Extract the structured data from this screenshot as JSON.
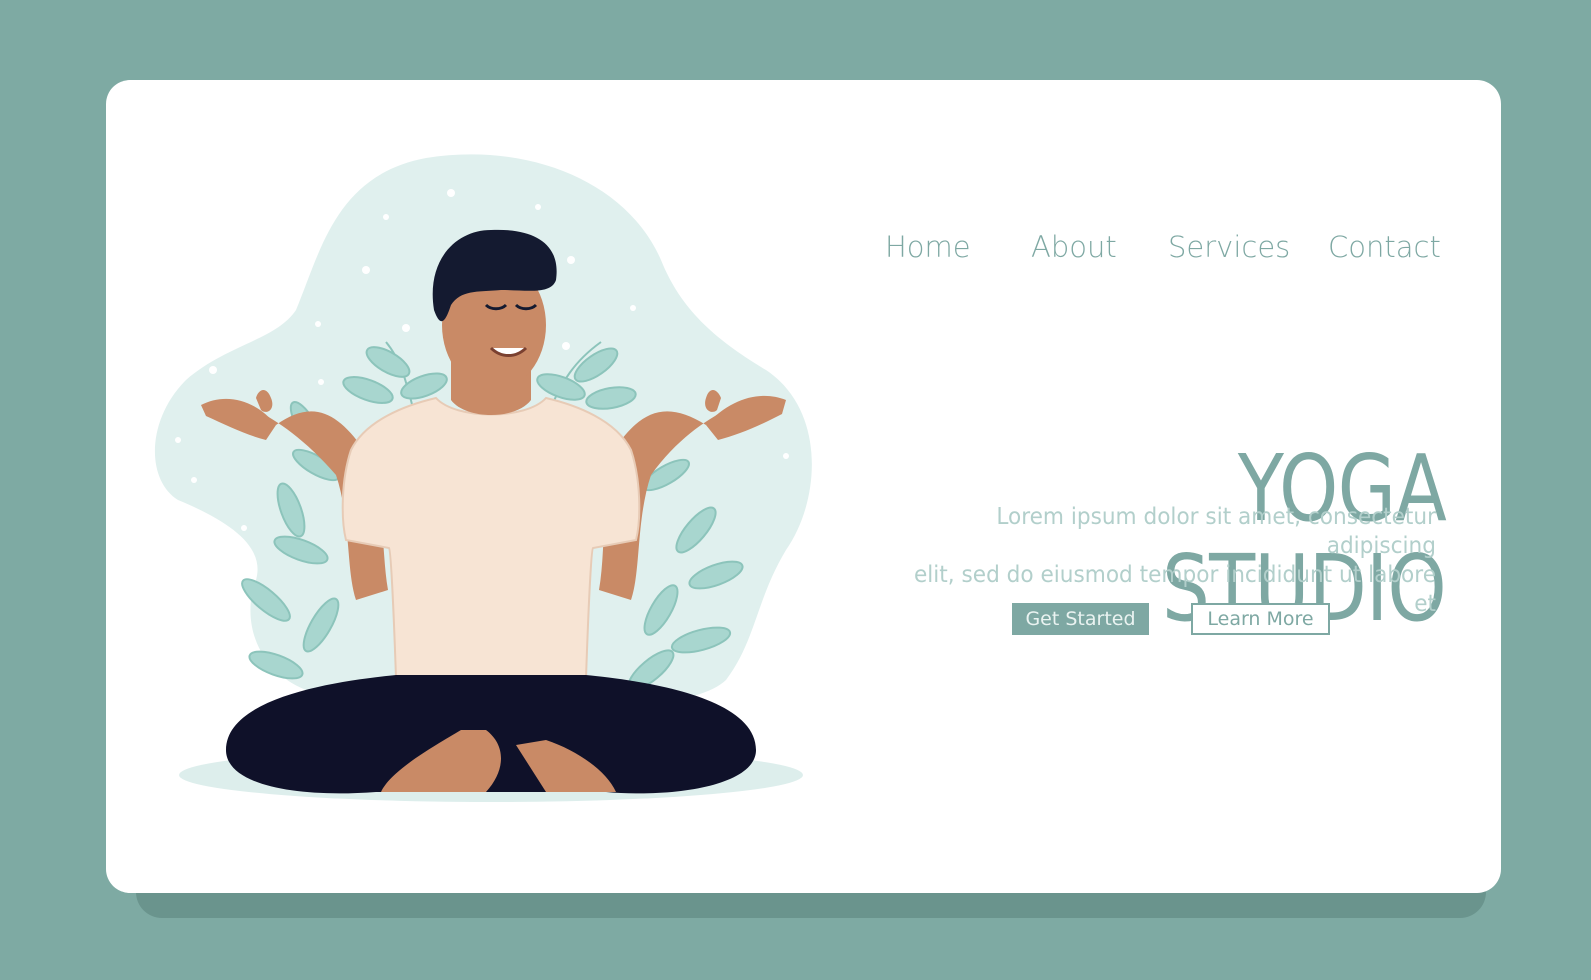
{
  "nav": {
    "items": [
      {
        "label": "Home"
      },
      {
        "label": "About"
      },
      {
        "label": "Services"
      },
      {
        "label": "Contact"
      }
    ]
  },
  "hero": {
    "title": "YOGA STUDIO",
    "description_line1": "Lorem ipsum dolor sit amet, consectetur adipiscing",
    "description_line2": "elit, sed do eiusmod tempor incididunt ut labore et",
    "primary_button": "Get Started",
    "secondary_button": "Learn More"
  },
  "colors": {
    "background": "#7eaaa3",
    "card": "#ffffff",
    "accent": "#7ea8a3",
    "blob": "#e0f0ee",
    "leaf": "#a8d6cf",
    "skin": "#c98a66",
    "shirt": "#f7e4d4",
    "pants": "#0f1129",
    "hair": "#141a30"
  },
  "illustration": {
    "subject": "man-meditating-lotus-pose"
  }
}
